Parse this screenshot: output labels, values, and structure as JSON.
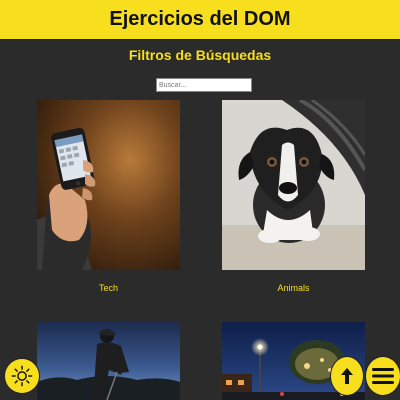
{
  "header": {
    "title": "Ejercicios del DOM"
  },
  "filters": {
    "title": "Filtros de Búsquedas",
    "search_placeholder": "Buscar..."
  },
  "cards": [
    {
      "label": "Tech",
      "image": "phone-in-hand-photo"
    },
    {
      "label": "Animals",
      "image": "puppy-photo"
    },
    {
      "label": "",
      "image": "golfer-silhouette-photo"
    },
    {
      "label": "",
      "image": "night-street-lights-photo"
    }
  ],
  "buttons": {
    "theme_icon": "sun-icon",
    "scroll_top_icon": "arrow-up-icon",
    "menu_icon": "hamburger-menu-icon"
  },
  "colors": {
    "accent": "#f7df1e",
    "background": "#2b2b2b"
  }
}
